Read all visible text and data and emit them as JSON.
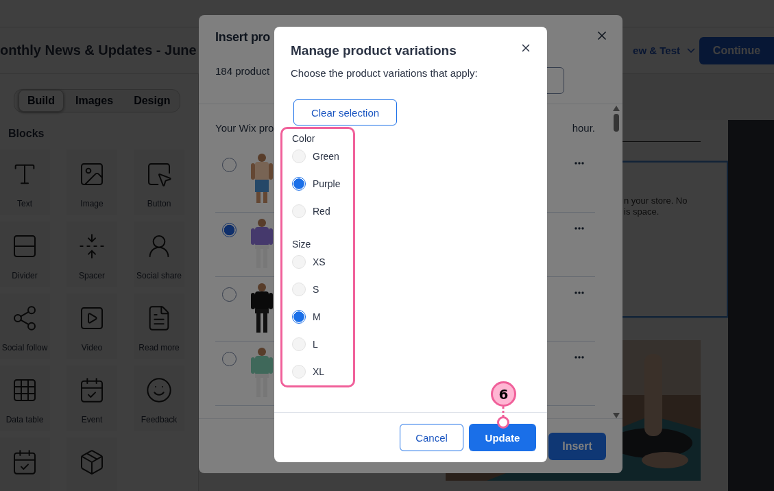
{
  "editor": {
    "title": "onthly News & Updates - June",
    "preview_menu": "ew & Test",
    "continue_button": "Continue",
    "sidebar_tabs": [
      {
        "label": "Build",
        "selected": true
      },
      {
        "label": "Images",
        "selected": false
      },
      {
        "label": "Design",
        "selected": false
      }
    ],
    "blocks_heading": "Blocks",
    "blocks": [
      {
        "label": "Text"
      },
      {
        "label": "Image"
      },
      {
        "label": "Button"
      },
      {
        "label": "Divider"
      },
      {
        "label": "Spacer"
      },
      {
        "label": "Social share"
      },
      {
        "label": "Social follow"
      },
      {
        "label": "Video"
      },
      {
        "label": "Read more"
      },
      {
        "label": "Data table"
      },
      {
        "label": "Event"
      },
      {
        "label": "Feedback"
      }
    ],
    "notice_lines": [
      "n your store. No",
      "is space."
    ]
  },
  "insert_dialog": {
    "title": "Insert pro",
    "count": "184 product",
    "notice_start": "Your Wix pro",
    "notice_end": "hour.",
    "products": [
      {
        "selected": false
      },
      {
        "selected": true
      },
      {
        "selected": false
      },
      {
        "selected": false
      }
    ],
    "insert_button": "Insert"
  },
  "variations_dialog": {
    "title": "Manage product variations",
    "subtitle": "Choose the product variations that apply:",
    "clear_button": "Clear selection",
    "groups": [
      {
        "name": "Color",
        "options": [
          {
            "label": "Green",
            "selected": false
          },
          {
            "label": "Purple",
            "selected": true
          },
          {
            "label": "Red",
            "selected": false
          }
        ]
      },
      {
        "name": "Size",
        "options": [
          {
            "label": "XS",
            "selected": false
          },
          {
            "label": "S",
            "selected": false
          },
          {
            "label": "M",
            "selected": true
          },
          {
            "label": "L",
            "selected": false
          },
          {
            "label": "XL",
            "selected": false
          }
        ]
      }
    ],
    "cancel_button": "Cancel",
    "update_button": "Update"
  },
  "callout": {
    "number": "6"
  }
}
